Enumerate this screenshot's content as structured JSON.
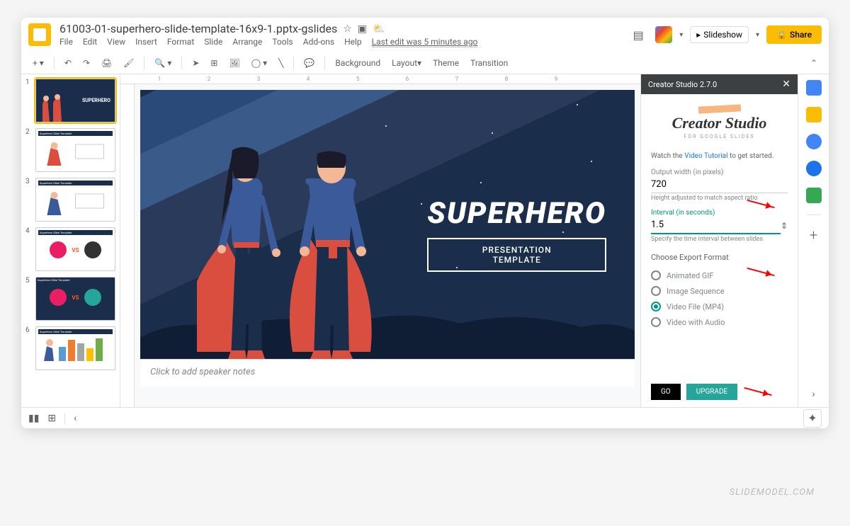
{
  "doc": {
    "title": "61003-01-superhero-slide-template-16x9-1.pptx-gslides",
    "last_edit": "Last edit was 5 minutes ago"
  },
  "menubar": [
    "File",
    "Edit",
    "View",
    "Insert",
    "Format",
    "Slide",
    "Arrange",
    "Tools",
    "Add-ons",
    "Help"
  ],
  "buttons": {
    "slideshow": "Slideshow",
    "share": "Share"
  },
  "toolbar": {
    "background": "Background",
    "layout": "Layout",
    "theme": "Theme",
    "transition": "Transition"
  },
  "ruler_h": [
    "1",
    "2",
    "3",
    "4",
    "5",
    "6",
    "7",
    "8",
    "9"
  ],
  "slide": {
    "title": "SUPERHERO",
    "subtitle_line1": "PRESENTATION",
    "subtitle_line2": "TEMPLATE"
  },
  "notes": {
    "placeholder": "Click to add speaker notes"
  },
  "thumbs": {
    "t1": "SUPERHERO",
    "header": "Superhero Slide Template",
    "vs": "VS"
  },
  "creator": {
    "header": "Creator Studio 2.7.0",
    "brand": "Creator Studio",
    "brand_sub": "FOR GOOGLE SLIDES",
    "watch": "Watch the ",
    "tutorial": "Video Tutorial",
    "watch_end": " to get started.",
    "width_label": "Output width (in pixels)",
    "width_value": "720",
    "width_hint": "Height adjusted to match aspect ratio",
    "interval_label": "Interval (in seconds)",
    "interval_value": "1.5",
    "interval_hint": "Specify the time interval between slides",
    "format_label": "Choose Export Format",
    "opt_gif": "Animated GIF",
    "opt_seq": "Image Sequence",
    "opt_mp4": "Video File (MP4)",
    "opt_audio": "Video with Audio",
    "go": "GO",
    "upgrade": "UPGRADE"
  },
  "watermark": "SLIDEMODEL.COM"
}
